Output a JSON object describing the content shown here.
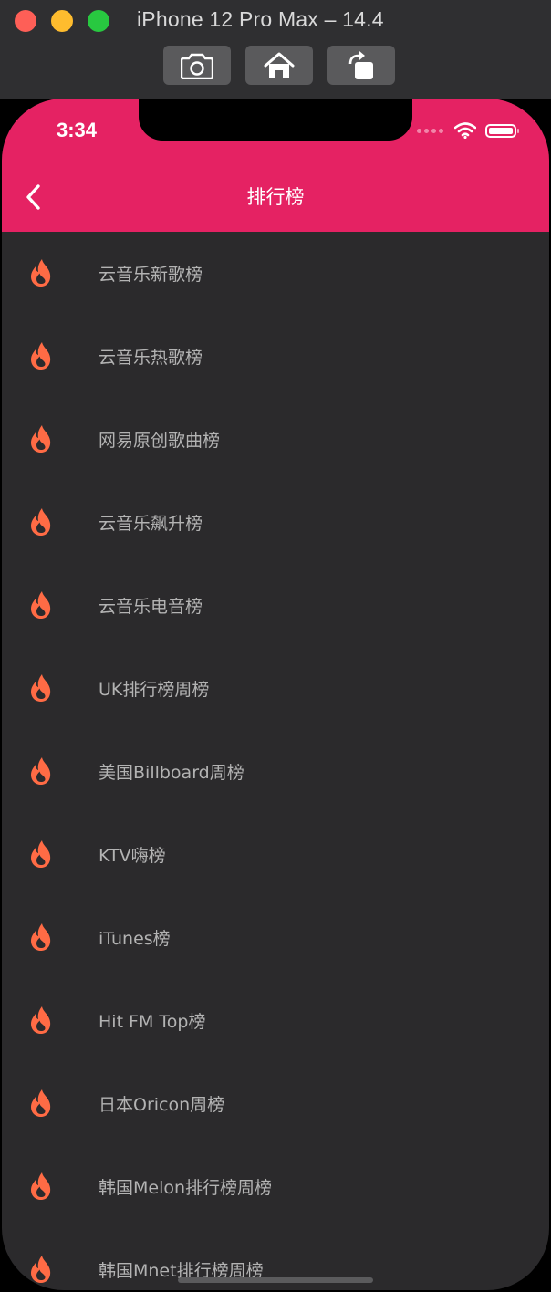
{
  "window": {
    "title": "iPhone 12 Pro Max – 14.4",
    "buttons": [
      "screenshot",
      "home",
      "rotate"
    ]
  },
  "status_bar": {
    "time": "3:34"
  },
  "nav": {
    "title": "排行榜",
    "back_icon": "chevron-left-icon"
  },
  "colors": {
    "header": "#e52263",
    "background": "#2b2a2c",
    "flame": "#ff6b45",
    "label": "#b3b3b3"
  },
  "list": {
    "icon": "flame-icon",
    "items": [
      {
        "label": "云音乐新歌榜"
      },
      {
        "label": "云音乐热歌榜"
      },
      {
        "label": "网易原创歌曲榜"
      },
      {
        "label": "云音乐飙升榜"
      },
      {
        "label": "云音乐电音榜"
      },
      {
        "label": "UK排行榜周榜"
      },
      {
        "label": "美国Billboard周榜"
      },
      {
        "label": "KTV嗨榜"
      },
      {
        "label": "iTunes榜"
      },
      {
        "label": "Hit FM Top榜"
      },
      {
        "label": "日本Oricon周榜"
      },
      {
        "label": "韩国Melon排行榜周榜"
      },
      {
        "label": "韩国Mnet排行榜周榜"
      }
    ]
  }
}
